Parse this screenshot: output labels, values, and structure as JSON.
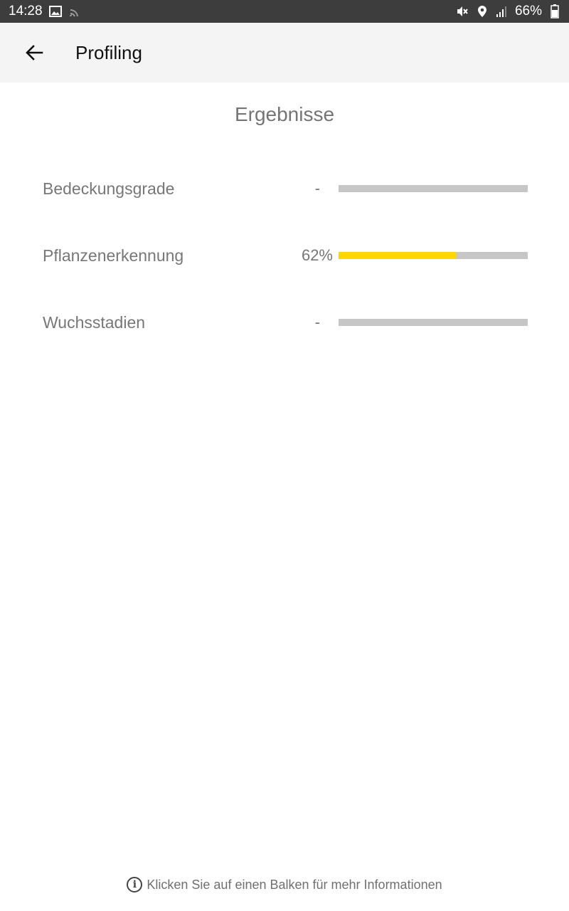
{
  "status_bar": {
    "time": "14:28",
    "battery": "66%",
    "icons": [
      "image-icon",
      "cast-icon",
      "mute-icon",
      "location-icon",
      "signal-icon",
      "battery-icon"
    ]
  },
  "app_bar": {
    "title": "Profiling",
    "back_icon": "arrow-left-icon"
  },
  "results": {
    "heading": "Ergebnisse",
    "rows": [
      {
        "label": "Bedeckungsgrade",
        "value": "-",
        "progress": 0
      },
      {
        "label": "Pflanzenerkennung",
        "value": "62%",
        "progress": 0.62
      },
      {
        "label": "Wuchsstadien",
        "value": "-",
        "progress": 0
      }
    ]
  },
  "footer": {
    "hint": "Klicken Sie auf einen Balken für mehr Informationen",
    "icon": "info-icon"
  },
  "colors": {
    "status_bar": "#3d3d3d",
    "app_bar": "#f4f4f4",
    "bar_track": "#c6c6c6",
    "bar_fill": "#ffd600",
    "text_muted": "#777777"
  }
}
